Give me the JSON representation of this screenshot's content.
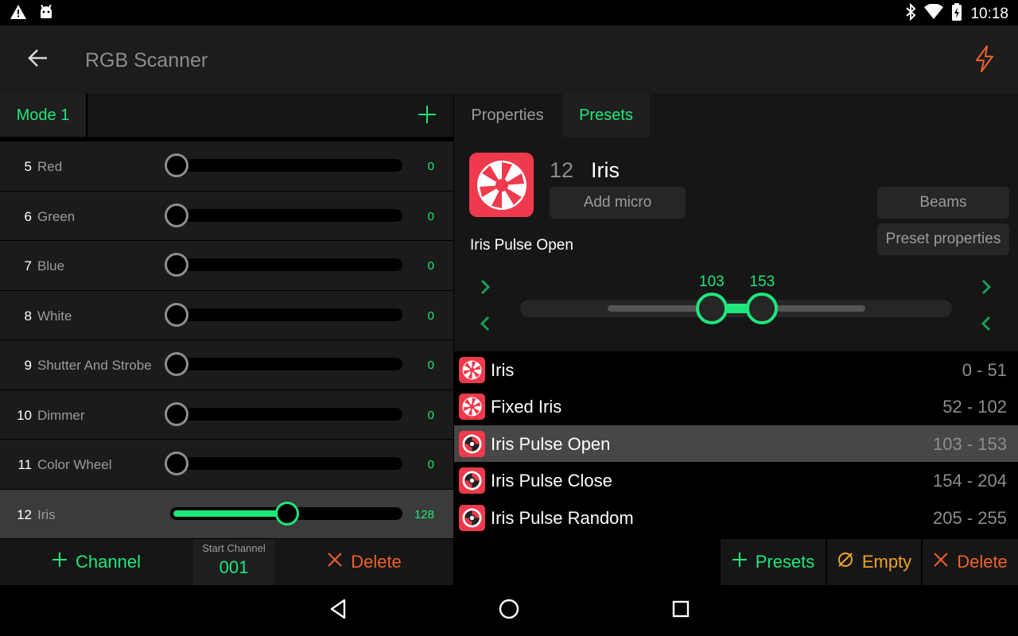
{
  "status_bar": {
    "time": "10:18",
    "icons": [
      "warning-icon",
      "android-icon",
      "bluetooth-icon",
      "wifi-icon",
      "battery-icon"
    ]
  },
  "app_bar": {
    "title": "RGB Scanner",
    "back_icon": "arrow-back-icon",
    "action_icon": "flash-icon"
  },
  "left": {
    "mode_tab": "Mode 1",
    "channels": [
      {
        "num": "5",
        "name": "Red",
        "value": "0",
        "level": 0
      },
      {
        "num": "6",
        "name": "Green",
        "value": "0",
        "level": 0
      },
      {
        "num": "7",
        "name": "Blue",
        "value": "0",
        "level": 0
      },
      {
        "num": "8",
        "name": "White",
        "value": "0",
        "level": 0
      },
      {
        "num": "9",
        "name": "Shutter And Strobe",
        "value": "0",
        "level": 0
      },
      {
        "num": "10",
        "name": "Dimmer",
        "value": "0",
        "level": 0
      },
      {
        "num": "11",
        "name": "Color Wheel",
        "value": "0",
        "level": 0
      },
      {
        "num": "12",
        "name": "Iris",
        "value": "128",
        "level": 128,
        "selected": true
      }
    ],
    "bottom": {
      "channel_label": "Channel",
      "start_channel_label": "Start Channel",
      "start_channel_value": "001",
      "delete_label": "Delete"
    }
  },
  "right": {
    "tabs": [
      "Properties",
      "Presets"
    ],
    "active_tab": "Presets",
    "preset": {
      "number": "12",
      "name": "Iris",
      "add_micro": "Add micro",
      "beams": "Beams",
      "preset_properties": "Preset properties",
      "current": "Iris Pulse Open",
      "range_min": 103,
      "range_max": 153,
      "range_min_label": "103",
      "range_max_label": "153"
    },
    "presets": [
      {
        "name": "Iris",
        "range": "0 - 51",
        "icon": "iris-icon"
      },
      {
        "name": "Fixed Iris",
        "range": "52 - 102",
        "icon": "iris-icon"
      },
      {
        "name": "Iris Pulse Open",
        "range": "103 - 153",
        "icon": "iris-pulse-icon",
        "selected": true
      },
      {
        "name": "Iris Pulse Close",
        "range": "154 - 204",
        "icon": "iris-pulse-icon"
      },
      {
        "name": "Iris Pulse Random",
        "range": "205 - 255",
        "icon": "iris-pulse-icon"
      }
    ],
    "bottom": {
      "presets_label": "Presets",
      "empty_label": "Empty",
      "delete_label": "Delete"
    }
  },
  "nav_bar": {
    "icons": [
      "back-triangle-icon",
      "home-circle-icon",
      "recents-square-icon"
    ]
  },
  "colors": {
    "accent": "#1ee87a",
    "danger": "#f0602a",
    "warning": "#f0a22a",
    "iris_icon": "#ee3a4c"
  }
}
